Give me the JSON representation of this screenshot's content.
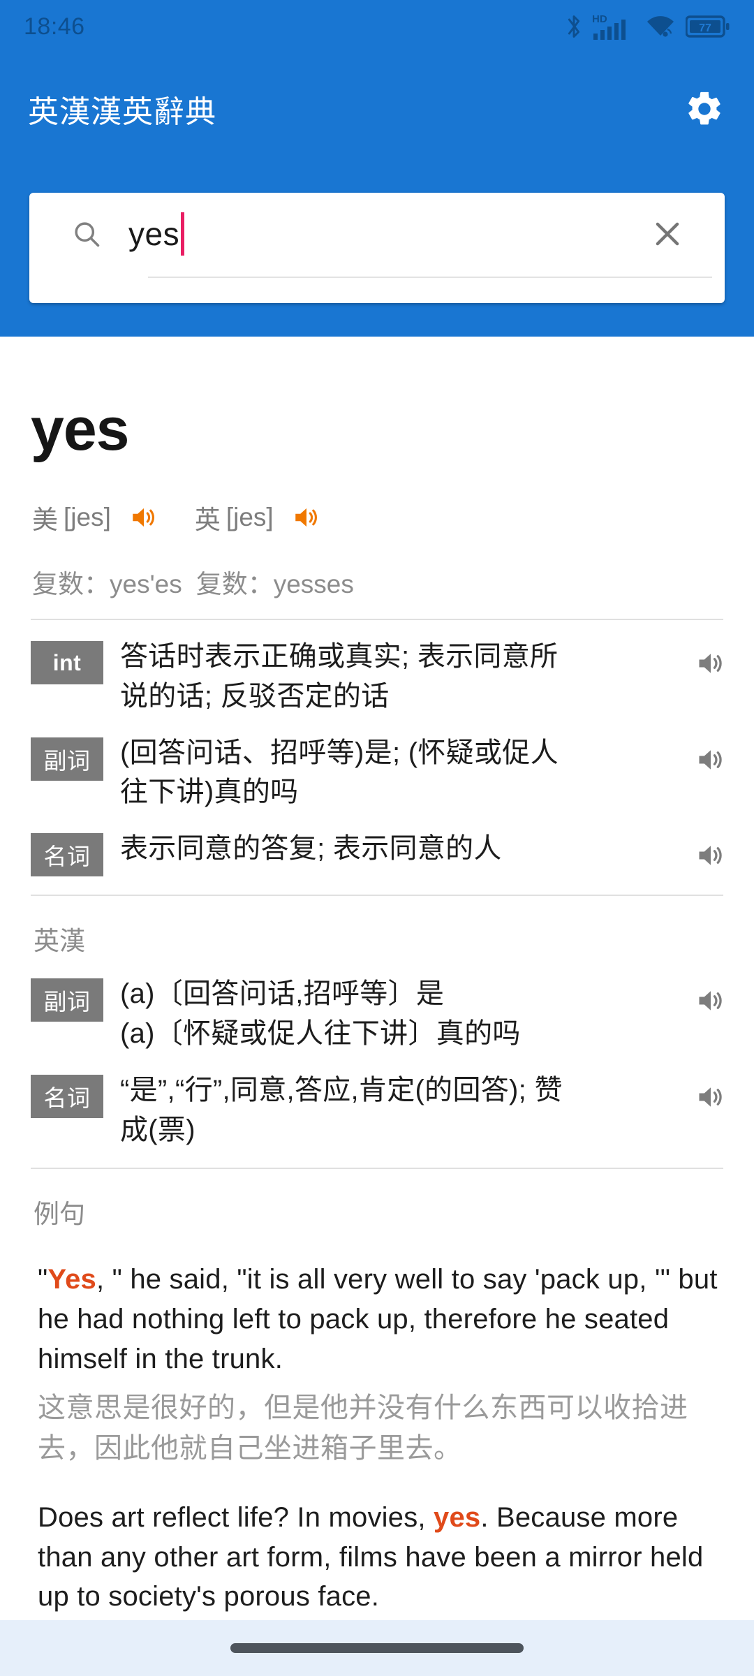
{
  "status_bar": {
    "time": "18:46",
    "battery_level": "77",
    "icons": [
      "bluetooth-icon",
      "hd-icon",
      "cellular-signal-icon",
      "wifi-icon",
      "battery-icon"
    ]
  },
  "app_bar": {
    "title": "英漢漢英辭典",
    "settings_icon": "gear-icon"
  },
  "search": {
    "value": "yes",
    "placeholder": "",
    "search_icon": "search-icon",
    "clear_icon": "close-icon"
  },
  "word": {
    "headword": "yes",
    "pronunciations": [
      {
        "region": "美",
        "ipa": "[jes]",
        "speaker_icon": "speaker-icon"
      },
      {
        "region": "英",
        "ipa": "[jes]",
        "speaker_icon": "speaker-icon"
      }
    ],
    "inflections": [
      "复数：yes'es",
      "复数：yesses"
    ]
  },
  "definitions_primary": [
    {
      "pos": "int",
      "pos_is_latin": true,
      "lines": [
        "答话时表示正确或真实; 表示同意所",
        "说的话; 反驳否定的话"
      ],
      "speaker_icon": "speaker-icon"
    },
    {
      "pos": "副词",
      "pos_is_latin": false,
      "lines": [
        "(回答问话、招呼等)是; (怀疑或促人",
        "往下讲)真的吗"
      ],
      "speaker_icon": "speaker-icon"
    },
    {
      "pos": "名词",
      "pos_is_latin": false,
      "lines": [
        "表示同意的答复; 表示同意的人"
      ],
      "speaker_icon": "speaker-icon"
    }
  ],
  "section_ec": {
    "label": "英漢",
    "definitions": [
      {
        "pos": "副词",
        "pos_is_latin": false,
        "lines": [
          "(a)〔回答问话,招呼等〕是",
          "(a)〔怀疑或促人往下讲〕真的吗"
        ],
        "speaker_icon": "speaker-icon"
      },
      {
        "pos": "名词",
        "pos_is_latin": false,
        "lines": [
          "“是”,“行”,同意,答应,肯定(的回答); 赞",
          "成(票)"
        ],
        "speaker_icon": "speaker-icon"
      }
    ]
  },
  "section_examples": {
    "label": "例句",
    "items": [
      {
        "en_prefix": "\"",
        "en_highlight": "Yes",
        "en_suffix": ", \" he said, \"it is all very well to say 'pack up, '\" but he had nothing left to pack up, therefore he seated himself in the trunk.",
        "zh": "这意思是很好的，但是他并没有什么东西可以收拾进去，因此他就自己坐进箱子里去。"
      },
      {
        "en_prefix": "Does art reflect life? In movies, ",
        "en_highlight": "yes",
        "en_suffix": ". Because more than any other art form, films have been a mirror held up to society's porous face.",
        "zh": ""
      }
    ]
  },
  "nav_bar": {
    "home_pill": "home-indicator"
  },
  "colors": {
    "primary": "#1976d2",
    "accent_orange": "#f07800",
    "highlight_orange": "#e04a1a",
    "badge_gray": "#7a7a7a",
    "caret_pink": "#e91e63",
    "navbar_bg": "#e6effa"
  }
}
